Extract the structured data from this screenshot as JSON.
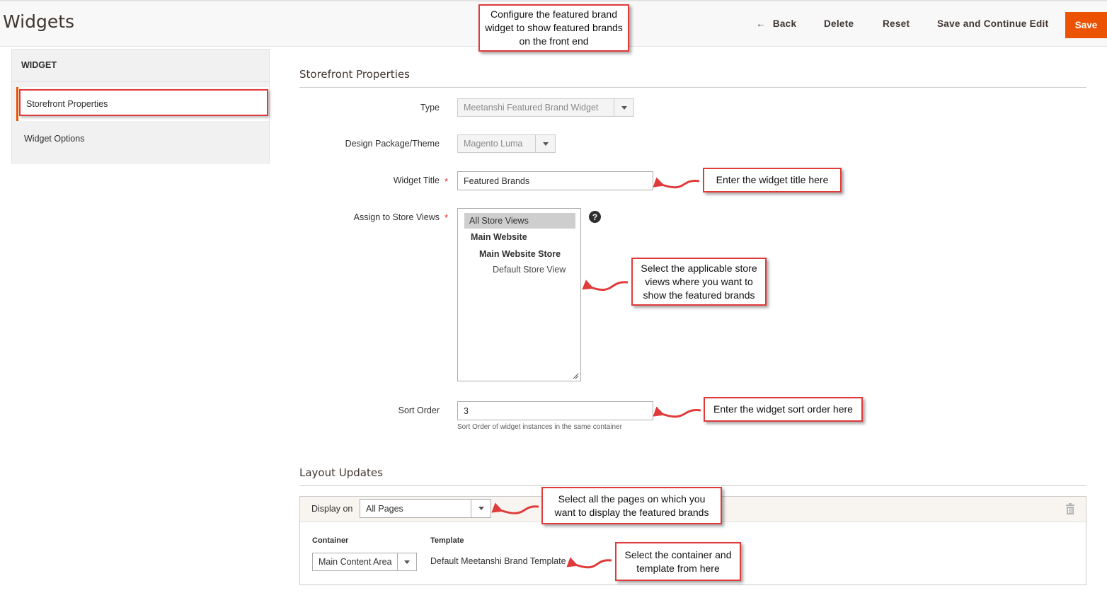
{
  "header": {
    "title": "Widgets",
    "back_label": "Back",
    "delete_label": "Delete",
    "reset_label": "Reset",
    "save_continue_label": "Save and Continue Edit",
    "save_label": "Save",
    "accent_color": "#eb5202"
  },
  "sidebar": {
    "title": "WIDGET",
    "items": [
      {
        "label": "Storefront Properties",
        "active": true
      },
      {
        "label": "Widget Options",
        "active": false
      }
    ]
  },
  "storefront": {
    "section_title": "Storefront Properties",
    "type_label": "Type",
    "type_value": "Meetanshi Featured Brand Widget",
    "theme_label": "Design Package/Theme",
    "theme_value": "Magento Luma",
    "title_label": "Widget Title",
    "title_value": "Featured Brands",
    "store_views_label": "Assign to Store Views",
    "store_views": {
      "all": "All Store Views",
      "website": "Main Website",
      "store": "Main Website Store",
      "view": "Default Store View",
      "selected": "All Store Views"
    },
    "help_icon": "?",
    "sort_label": "Sort Order",
    "sort_value": "3",
    "sort_note": "Sort Order of widget instances in the same container",
    "required_mark": "*"
  },
  "layout_updates": {
    "section_title": "Layout Updates",
    "display_on_label": "Display on",
    "display_on_value": "All Pages",
    "container_label": "Container",
    "container_value": "Main Content Area",
    "template_label": "Template",
    "template_value": "Default Meetanshi Brand Template"
  },
  "callouts": {
    "top": "Configure the featured brand widget to show featured brands on the front end",
    "title": "Enter the widget title here",
    "store_views": "Select the applicable store views where you want to show the featured brands",
    "sort": "Enter the widget sort order here",
    "display_on": "Select all the pages on which you want to display the featured brands",
    "container": "Select the container and template from here",
    "color": "#e03b3b"
  }
}
